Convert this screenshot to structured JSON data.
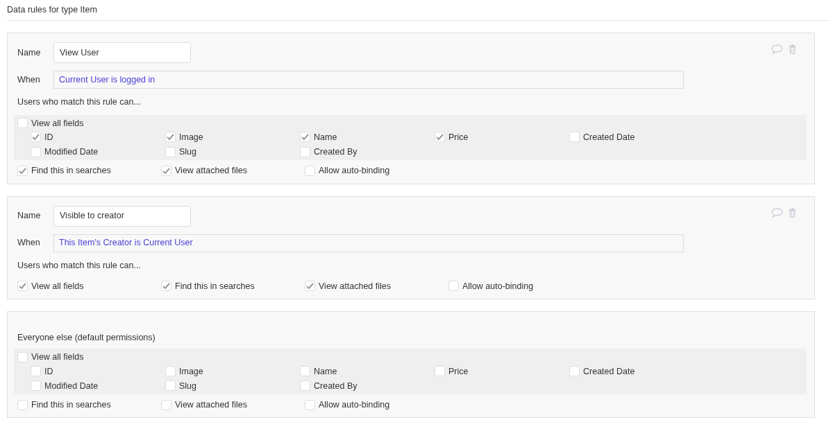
{
  "title": "Data rules for type Item",
  "rules": [
    {
      "kind": "rule",
      "name_label": "Name",
      "name": "View User",
      "when_label": "When",
      "when": "Current User is logged in",
      "can_label": "Users who match this rule can...",
      "view_all": {
        "label": "View all fields",
        "checked": false
      },
      "fields": [
        {
          "label": "ID",
          "checked": true
        },
        {
          "label": "Image",
          "checked": true
        },
        {
          "label": "Name",
          "checked": true
        },
        {
          "label": "Price",
          "checked": true
        },
        {
          "label": "Created Date",
          "checked": false
        },
        {
          "label": "Modified Date",
          "checked": false
        },
        {
          "label": "Slug",
          "checked": false
        },
        {
          "label": "Created By",
          "checked": false
        }
      ],
      "options": [
        {
          "label": "Find this in searches",
          "checked": true
        },
        {
          "label": "View attached files",
          "checked": true
        },
        {
          "label": "Allow auto-binding",
          "checked": false
        }
      ]
    },
    {
      "kind": "rule",
      "name_label": "Name",
      "name": "Visible to creator",
      "when_label": "When",
      "when": "This Item's Creator is Current User",
      "can_label": "Users who match this rule can...",
      "view_all": {
        "label": "View all fields",
        "checked": true
      },
      "options": [
        {
          "label": "Find this in searches",
          "checked": true
        },
        {
          "label": "View attached files",
          "checked": true
        },
        {
          "label": "Allow auto-binding",
          "checked": false
        }
      ]
    },
    {
      "kind": "default",
      "heading": "Everyone else (default permissions)",
      "view_all": {
        "label": "View all fields",
        "checked": false
      },
      "fields": [
        {
          "label": "ID",
          "checked": false
        },
        {
          "label": "Image",
          "checked": false
        },
        {
          "label": "Name",
          "checked": false
        },
        {
          "label": "Price",
          "checked": false
        },
        {
          "label": "Created Date",
          "checked": false
        },
        {
          "label": "Modified Date",
          "checked": false
        },
        {
          "label": "Slug",
          "checked": false
        },
        {
          "label": "Created By",
          "checked": false
        }
      ],
      "options": [
        {
          "label": "Find this in searches",
          "checked": false
        },
        {
          "label": "View attached files",
          "checked": false
        },
        {
          "label": "Allow auto-binding",
          "checked": false
        }
      ]
    }
  ]
}
